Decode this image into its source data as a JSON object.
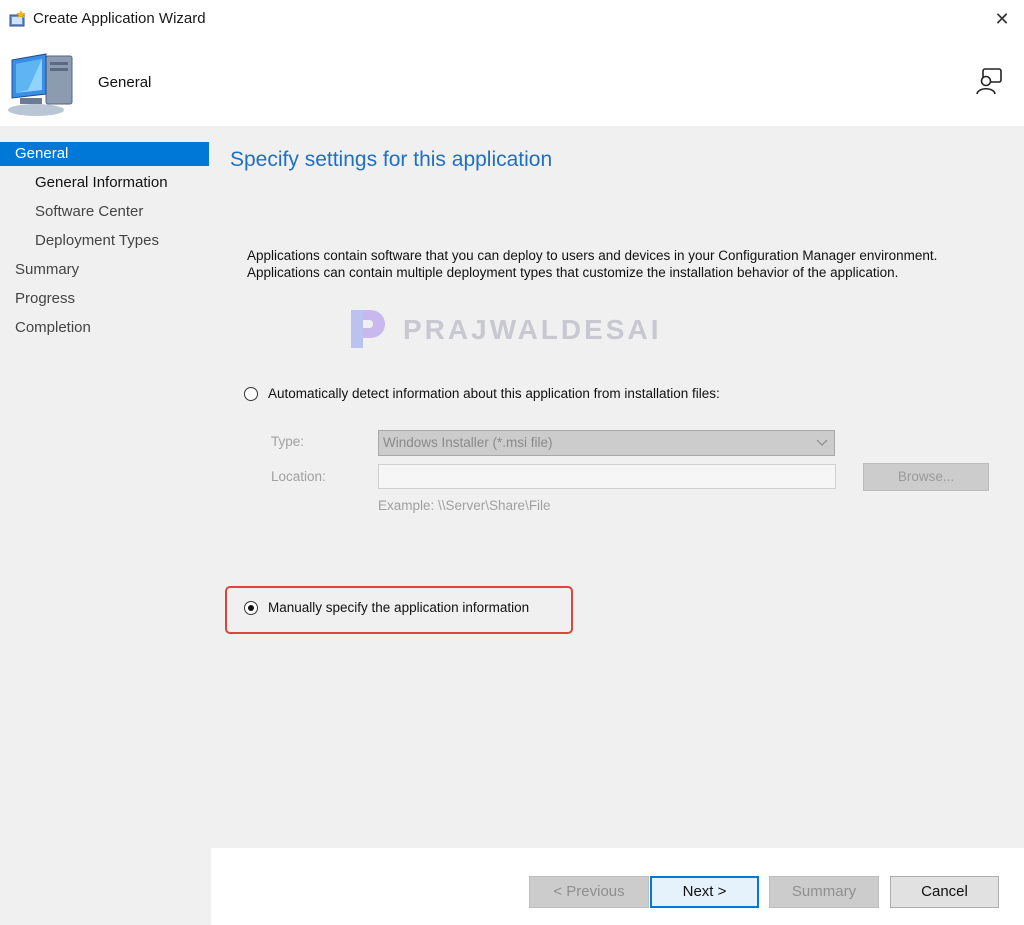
{
  "window": {
    "title": "Create Application Wizard",
    "close_symbol": "✕",
    "icon": "wizard-app-icon"
  },
  "header": {
    "title": "General",
    "icon": "computer-icon",
    "feedback_icon": "feedback-person-icon"
  },
  "sidebar": {
    "items": [
      {
        "label": "General",
        "active": true
      },
      {
        "label": "General Information",
        "sub": true,
        "bold": true
      },
      {
        "label": "Software Center",
        "sub": true
      },
      {
        "label": "Deployment Types",
        "sub": true
      },
      {
        "label": "Summary"
      },
      {
        "label": "Progress"
      },
      {
        "label": "Completion"
      }
    ]
  },
  "content": {
    "heading": "Specify settings for this application",
    "description_line1": "Applications contain software that you can deploy to users and devices in your Configuration Manager environment.",
    "description_line2": "Applications can contain multiple deployment types that customize the installation behavior of the application.",
    "watermark": "PRAJWALDESAI",
    "auto_detect": {
      "label": "Automatically detect information about this application from installation files:",
      "selected": false,
      "type_label": "Type:",
      "type_value": "Windows Installer (*.msi file)",
      "location_label": "Location:",
      "location_value": "",
      "browse_label": "Browse...",
      "example": "Example: \\\\Server\\Share\\File"
    },
    "manual": {
      "label": "Manually specify the application information",
      "selected": true
    }
  },
  "footer": {
    "previous": "< Previous",
    "next": "Next >",
    "summary": "Summary",
    "cancel": "Cancel"
  },
  "colors": {
    "accent": "#0078d7",
    "heading": "#1f6fc4",
    "highlight": "#e0443e"
  }
}
